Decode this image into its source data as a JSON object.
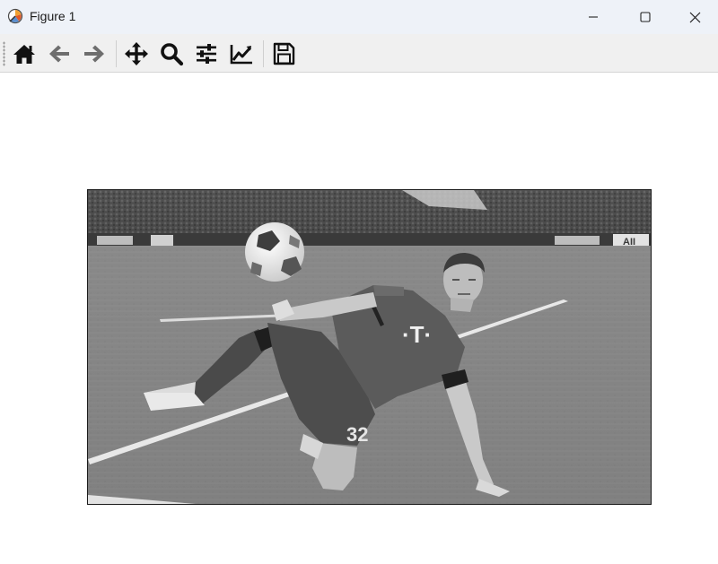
{
  "window": {
    "title": "Figure 1",
    "app_icon": "matplotlib-figure-icon",
    "controls": [
      "minimize-icon",
      "maximize-icon",
      "close-icon"
    ]
  },
  "toolbar": {
    "tools": [
      {
        "name": "home",
        "icon": "home-icon"
      },
      {
        "name": "back",
        "icon": "back-arrow-icon"
      },
      {
        "name": "forward",
        "icon": "forward-arrow-icon"
      },
      {
        "name": "pan",
        "icon": "move-arrows-icon"
      },
      {
        "name": "zoom",
        "icon": "magnifier-icon"
      },
      {
        "name": "subplots",
        "icon": "sliders-icon"
      },
      {
        "name": "edit-axes",
        "icon": "line-chart-icon"
      },
      {
        "name": "save",
        "icon": "floppy-disk-icon"
      }
    ]
  },
  "figure": {
    "image": {
      "description_colors": "grayscale",
      "jersey_number": "32"
    }
  }
}
